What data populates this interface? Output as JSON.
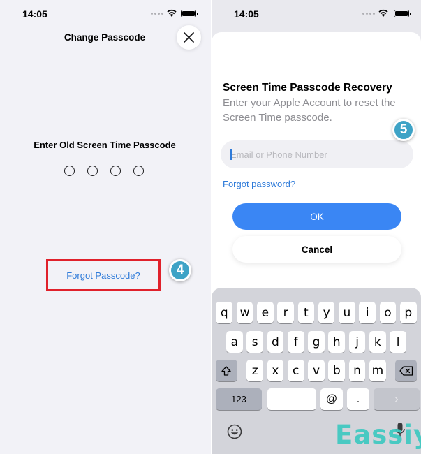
{
  "left_screen": {
    "status": {
      "time": "14:05"
    },
    "title": "Change Passcode",
    "prompt": "Enter Old Screen Time Passcode",
    "passcode_dot_count": 4,
    "forgot_link": "Forgot Passcode?",
    "step_badge": "4",
    "highlight_color": "#e0212b"
  },
  "right_screen": {
    "status": {
      "time": "14:05"
    },
    "sheet_title": "Screen Time Passcode Recovery",
    "sheet_description": "Enter your Apple Account to reset the Screen Time passcode.",
    "email_input": {
      "value": "",
      "placeholder": "Email or Phone Number"
    },
    "forgot_password": "Forgot password?",
    "ok_label": "OK",
    "cancel_label": "Cancel",
    "step_badge": "5",
    "keyboard": {
      "row1": [
        "q",
        "w",
        "e",
        "r",
        "t",
        "y",
        "u",
        "i",
        "o",
        "p"
      ],
      "row2": [
        "a",
        "s",
        "d",
        "f",
        "g",
        "h",
        "j",
        "k",
        "l"
      ],
      "row3": [
        "z",
        "x",
        "c",
        "v",
        "b",
        "n",
        "m"
      ],
      "numbers_key": "123",
      "at_key": "@",
      "dot_key": ".",
      "return_key": "›"
    }
  },
  "watermark": "Eassiy",
  "colors": {
    "accent": "#2f7bd9",
    "ok_button": "#3a86f4",
    "badge": "#3ea3c6",
    "watermark": "#3ec9c0"
  }
}
